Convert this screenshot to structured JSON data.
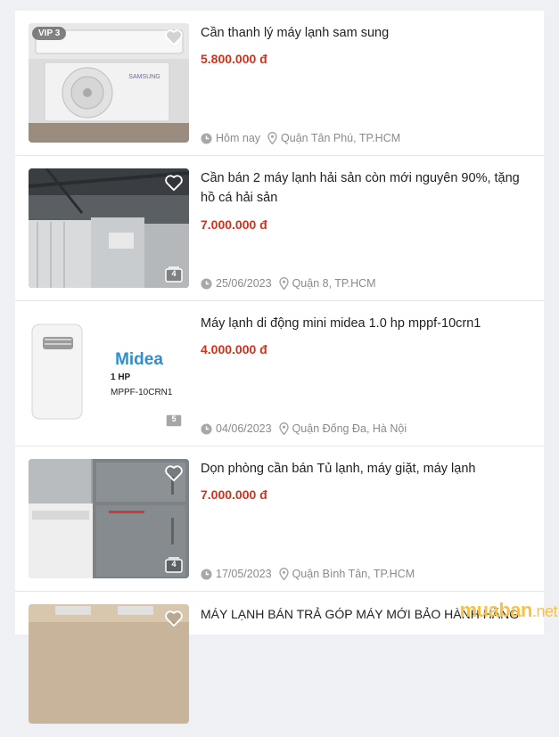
{
  "listings": [
    {
      "badge": "VIP 3",
      "title": "Cần thanh lý máy lạnh sam sung",
      "price": "5.800.000 đ",
      "date": "Hôm nay",
      "location": "Quận Tân Phú, TP.HCM",
      "thumb_text": "SAMSUNG"
    },
    {
      "title": "Cần bán 2 máy lạnh hải sản còn mới nguyên 90%, tặng hồ cá hải sản",
      "price": "7.000.000 đ",
      "date": "25/06/2023",
      "location": "Quận 8, TP.HCM",
      "photo_count": "4"
    },
    {
      "title": "Máy lạnh di động mini midea 1.0 hp mppf-10crn1",
      "price": "4.000.000 đ",
      "date": "04/06/2023",
      "location": "Quận Đống Đa, Hà Nội",
      "photo_count": "5",
      "thumb_brand": "Midea",
      "thumb_hp": "1 HP",
      "thumb_model": "MPPF-10CRN1"
    },
    {
      "title": "Dọn phòng cần bán Tủ lạnh, máy giặt, máy lạnh",
      "price": "7.000.000 đ",
      "date": "17/05/2023",
      "location": "Quận Bình Tân, TP.HCM",
      "photo_count": "4"
    },
    {
      "title": "MÁY LẠNH BÁN TRẢ GÓP MÁY MỚI BẢO HÀNH HÃNG"
    }
  ],
  "watermark": {
    "brand": "muaban",
    "suffix": ".net"
  },
  "colors": {
    "price": "#d0321b",
    "meta": "#8a8a8a",
    "watermark": "#f6c24a"
  }
}
